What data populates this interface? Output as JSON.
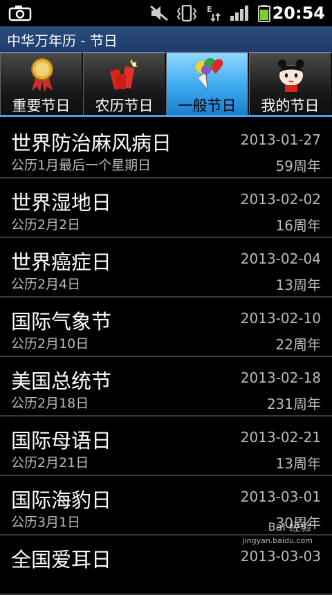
{
  "status_bar": {
    "time": "20:54",
    "icons": [
      "camera-icon",
      "mute-icon",
      "vibrate-icon",
      "data-transfer-icon",
      "signal-icon",
      "battery-icon"
    ]
  },
  "title_bar": {
    "title": "中华万年历 - 节日"
  },
  "tabs": [
    {
      "label": "重要节日",
      "icon": "medal-icon",
      "active": false
    },
    {
      "label": "农历节日",
      "icon": "firecracker-icon",
      "active": false
    },
    {
      "label": "一般节日",
      "icon": "balloons-icon",
      "active": true
    },
    {
      "label": "我的节日",
      "icon": "doll-icon",
      "active": false
    }
  ],
  "festivals": [
    {
      "name": "世界防治麻风病日",
      "rule": "公历1月最后一个星期日",
      "date": "2013-01-27",
      "years": "59周年"
    },
    {
      "name": "世界湿地日",
      "rule": "公历2月2日",
      "date": "2013-02-02",
      "years": "16周年"
    },
    {
      "name": "世界癌症日",
      "rule": "公历2月4日",
      "date": "2013-02-04",
      "years": "13周年"
    },
    {
      "name": "国际气象节",
      "rule": "公历2月10日",
      "date": "2013-02-10",
      "years": "22周年"
    },
    {
      "name": "美国总统节",
      "rule": "公历2月18日",
      "date": "2013-02-18",
      "years": "231周年"
    },
    {
      "name": "国际母语日",
      "rule": "公历2月21日",
      "date": "2013-02-21",
      "years": "13周年"
    },
    {
      "name": "国际海豹日",
      "rule": "公历3月1日",
      "date": "2013-03-01",
      "years": "30周年"
    },
    {
      "name": "全国爱耳日",
      "rule": "",
      "date": "2013-03-03",
      "years": ""
    }
  ],
  "watermark": {
    "text": "Bai 经验",
    "url": "jingyan.baidu.com"
  },
  "colors": {
    "title_bar": "#1f3c6b",
    "active_tab": "#3aa7ef",
    "divider": "#3a3a3a"
  }
}
